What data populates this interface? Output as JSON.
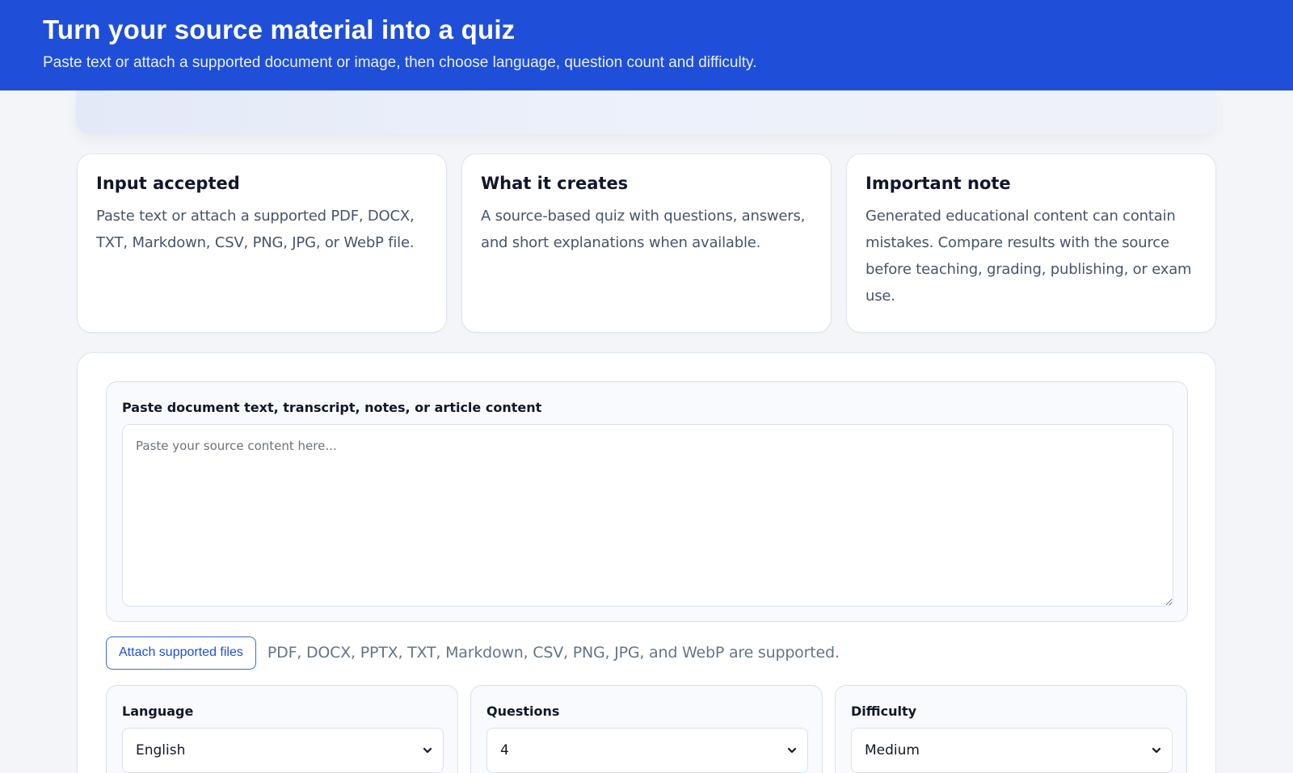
{
  "header": {
    "title": "Turn your source material into a quiz",
    "subtitle": "Paste text or attach a supported document or image, then choose language, question count and difficulty."
  },
  "info_cards": [
    {
      "title": "Input accepted",
      "body": "Paste text or attach a supported PDF, DOCX, TXT, Markdown, CSV, PNG, JPG, or WebP file."
    },
    {
      "title": "What it creates",
      "body": "A source-based quiz with questions, answers, and short explanations when available."
    },
    {
      "title": "Important note",
      "body": "Generated educational content can contain mistakes. Compare results with the source before teaching, grading, publishing, or exam use."
    }
  ],
  "source": {
    "label": "Paste document text, transcript, notes, or article content",
    "placeholder": "Paste your source content here...",
    "value": ""
  },
  "attach": {
    "button_label": "Attach supported files",
    "note": "PDF, DOCX, PPTX, TXT, Markdown, CSV, PNG, JPG, and WebP are supported."
  },
  "options": {
    "language": {
      "label": "Language",
      "value": "English",
      "icon": "chevron-down-icon"
    },
    "questions": {
      "label": "Questions",
      "value": "4",
      "icon": "chevron-down-icon"
    },
    "difficulty": {
      "label": "Difficulty",
      "value": "Medium",
      "icon": "chevron-down-icon"
    }
  },
  "colors": {
    "banner": "#1f4fd8",
    "accent": "#1d4ed8",
    "page_bg": "#f3f5f9"
  }
}
